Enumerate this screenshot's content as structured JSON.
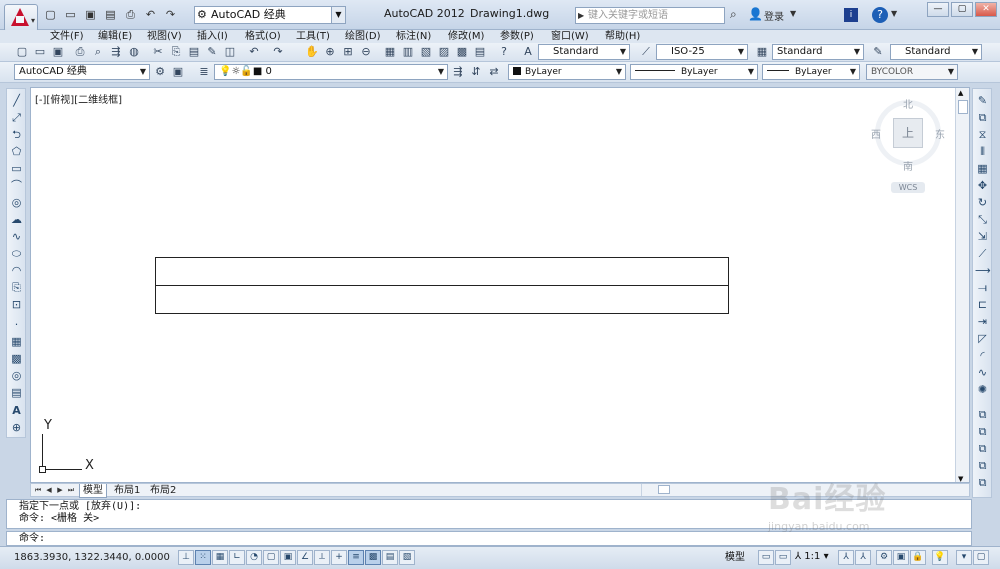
{
  "titlebar": {
    "workspace": "AutoCAD 经典",
    "app_name": "AutoCAD 2012",
    "document": "Drawing1.dwg",
    "search_placeholder": "键入关键字或短语",
    "login": "登录",
    "quick_access_icons": [
      "new-icon",
      "open-icon",
      "save-icon",
      "saveas-icon",
      "print-icon",
      "undo-icon",
      "redo-icon"
    ]
  },
  "menu": {
    "items": [
      "文件(F)",
      "编辑(E)",
      "视图(V)",
      "插入(I)",
      "格式(O)",
      "工具(T)",
      "绘图(D)",
      "标注(N)",
      "修改(M)",
      "参数(P)",
      "窗口(W)",
      "帮助(H)"
    ]
  },
  "toolbar1": {
    "text_style": "Standard",
    "dim_style": "ISO-25",
    "table_style": "Standard",
    "mleader_style": "Standard"
  },
  "toolbar2": {
    "workspace": "AutoCAD 经典",
    "layer": "0",
    "color": "ByLayer",
    "linetype": "ByLayer",
    "lineweight": "ByLayer",
    "plotstyle": "BYCOLOR"
  },
  "viewport": {
    "label": "[-][俯视][二维线框]"
  },
  "viewcube": {
    "north": "北",
    "south": "南",
    "east": "东",
    "west": "西",
    "face": "上",
    "wcs": "WCS"
  },
  "ucs": {
    "x": "X",
    "y": "Y"
  },
  "layout_tabs": [
    "模型",
    "布局1",
    "布局2"
  ],
  "command": {
    "history": [
      "指定下一点或 [放弃(U)]:",
      "命令: <栅格 关>"
    ],
    "prompt": "命令:"
  },
  "status": {
    "coordinates": "1863.3930, 1322.3440, 0.0000",
    "model": "模型",
    "scale": "1:1"
  },
  "watermark": {
    "brand": "Bai经验",
    "url": "jingyan.baidu.com"
  },
  "colors": {
    "accent": "#c8102e",
    "frame": "#c9d6e6",
    "canvas": "#ffffff"
  }
}
